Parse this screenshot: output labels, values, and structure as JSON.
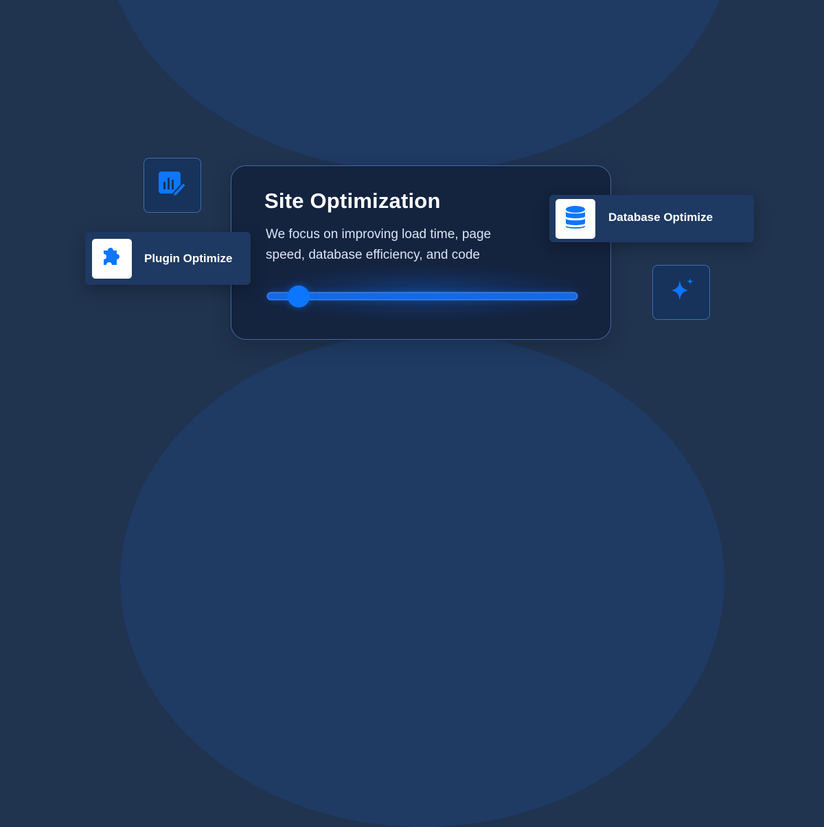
{
  "main_card": {
    "title": "Site Optimization",
    "description": "We focus on improving load time, page speed, database efficiency, and code"
  },
  "pills": {
    "plugin": {
      "label": "Plugin Optimize",
      "icon": "puzzle-piece-icon"
    },
    "database": {
      "label": "Database Optimize",
      "icon": "database-icon"
    }
  },
  "slider": {
    "value_percent": 10
  },
  "floating_icons": {
    "left": "chart-edit-icon",
    "right": "sparkle-icon"
  },
  "colors": {
    "background": "#20334f",
    "accent": "#0d76ff",
    "card_background": "#14233e",
    "pill_background": "#1e3962"
  }
}
